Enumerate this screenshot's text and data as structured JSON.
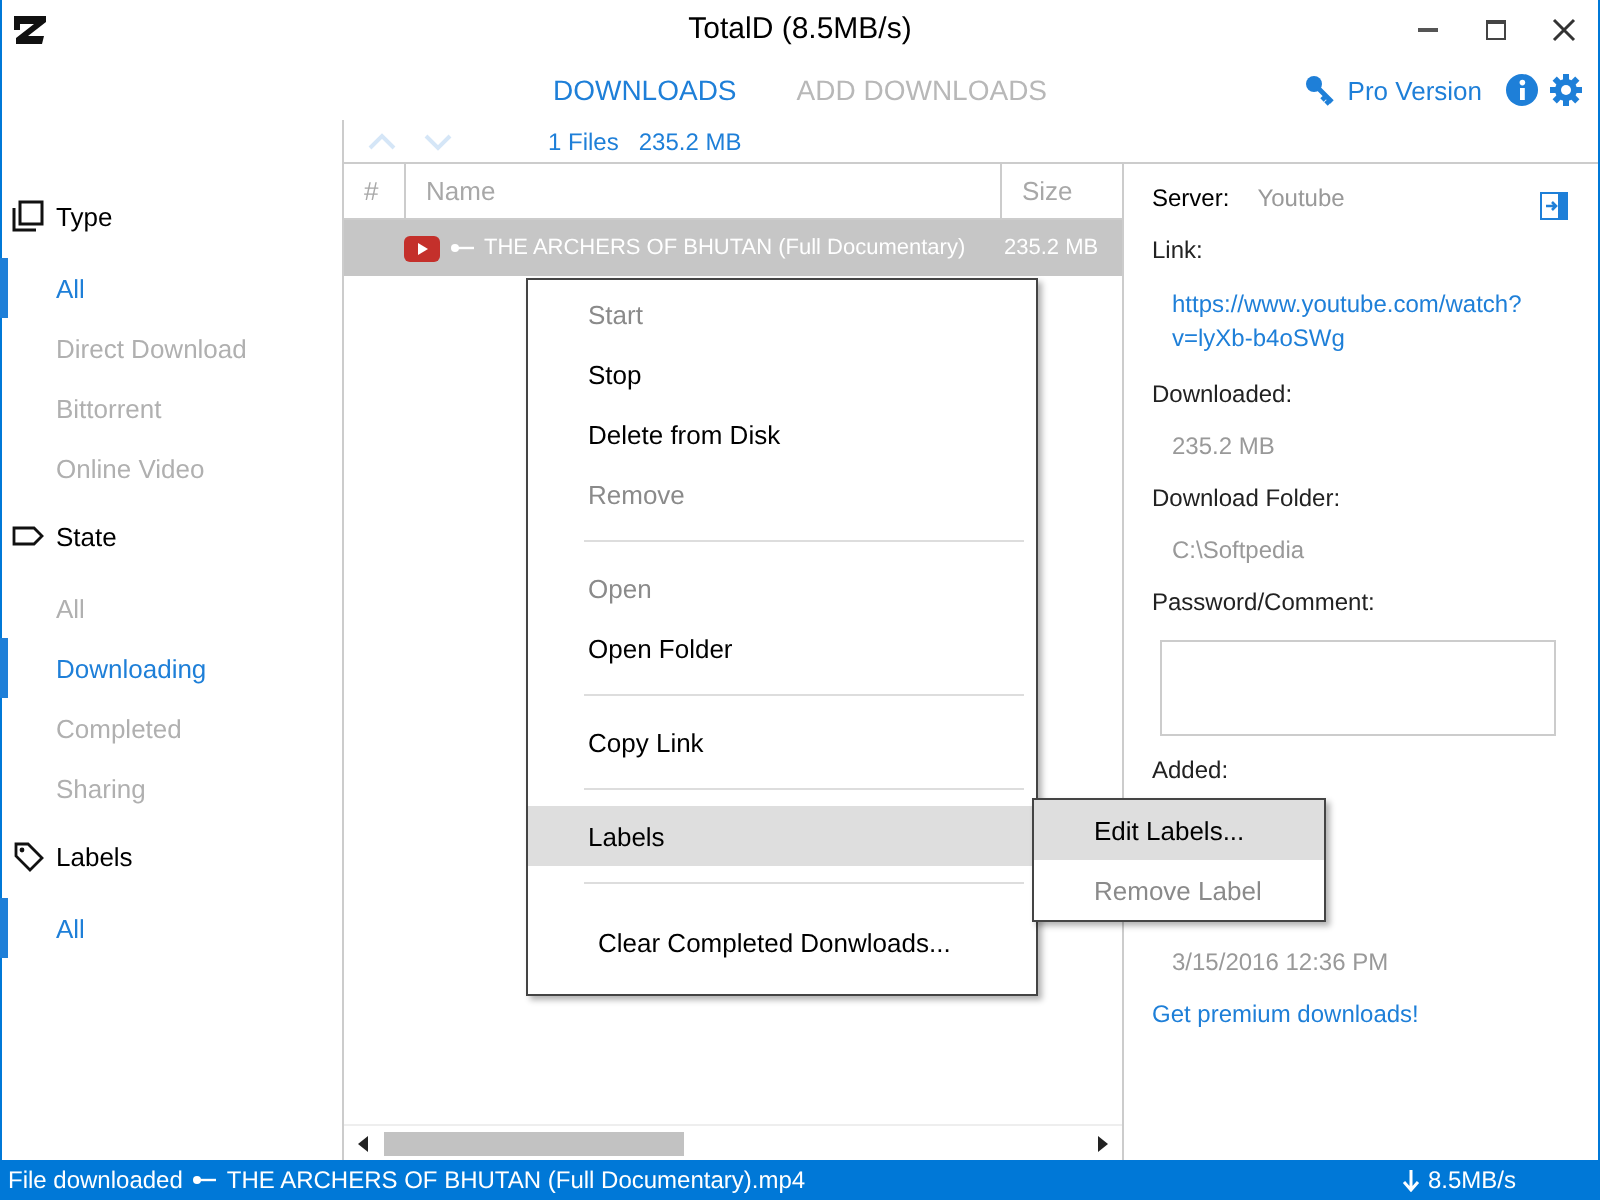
{
  "window": {
    "title": "TotalD (8.5MB/s)"
  },
  "tabs": [
    {
      "label": "DOWNLOADS",
      "selected": true
    },
    {
      "label": "ADD DOWNLOADS",
      "selected": false
    }
  ],
  "pro_link": "Pro Version",
  "toolbar": {
    "files": "1 Files",
    "size": "235.2 MB"
  },
  "sidebar": {
    "sections": [
      {
        "title": "Type",
        "items": [
          {
            "label": "All",
            "selected": true
          },
          {
            "label": "Direct Download",
            "selected": false
          },
          {
            "label": "Bittorrent",
            "selected": false
          },
          {
            "label": "Online Video",
            "selected": false
          }
        ]
      },
      {
        "title": "State",
        "items": [
          {
            "label": "All",
            "selected": false
          },
          {
            "label": "Downloading",
            "selected": true
          },
          {
            "label": "Completed",
            "selected": false
          },
          {
            "label": "Sharing",
            "selected": false
          }
        ]
      },
      {
        "title": "Labels",
        "items": [
          {
            "label": "All",
            "selected": true
          }
        ]
      }
    ]
  },
  "table": {
    "columns": [
      "#",
      "Name",
      "Size"
    ],
    "rows": [
      {
        "name": "THE ARCHERS OF BHUTAN (Full Documentary)",
        "size": "235.2 MB",
        "selected": true
      }
    ]
  },
  "details": {
    "server_label": "Server:",
    "server": "Youtube",
    "fields": [
      {
        "kind": "link",
        "label": "Link:",
        "value": "https://www.youtube.com/watch?v=lyXb-b4oSWg"
      },
      {
        "kind": "text",
        "label": "Downloaded:",
        "value": "235.2 MB"
      },
      {
        "kind": "text",
        "label": "Download Folder:",
        "value": "C:\\Softpedia"
      },
      {
        "kind": "input",
        "label": "Password/Comment:"
      },
      {
        "kind": "covered",
        "label": "Added:"
      },
      {
        "kind": "text",
        "value": "3/15/2016 12:36 PM"
      }
    ],
    "premium_link": "Get premium downloads!"
  },
  "context_menu": {
    "items": [
      {
        "kind": "item",
        "label": "Start",
        "disabled": true,
        "highlighted": false
      },
      {
        "kind": "item",
        "label": "Stop",
        "disabled": false,
        "highlighted": false
      },
      {
        "kind": "item",
        "label": "Delete from Disk",
        "disabled": false,
        "highlighted": false
      },
      {
        "kind": "item",
        "label": "Remove",
        "disabled": true,
        "highlighted": false
      },
      {
        "kind": "separator"
      },
      {
        "kind": "item",
        "label": "Open",
        "disabled": true,
        "highlighted": false
      },
      {
        "kind": "item",
        "label": "Open Folder",
        "disabled": false,
        "highlighted": false
      },
      {
        "kind": "separator"
      },
      {
        "kind": "item",
        "label": "Copy Link",
        "disabled": false,
        "highlighted": false
      },
      {
        "kind": "separator"
      },
      {
        "kind": "item",
        "label": "Labels",
        "disabled": false,
        "highlighted": true
      },
      {
        "kind": "separator"
      },
      {
        "kind": "item",
        "label": "Clear Completed Donwloads...",
        "disabled": false,
        "highlighted": false
      }
    ],
    "submenu": [
      {
        "label": "Edit Labels...",
        "disabled": false,
        "highlighted": true
      },
      {
        "label": "Remove Label",
        "disabled": true,
        "highlighted": false
      }
    ]
  },
  "status_bar": {
    "message": "File downloaded",
    "file": "THE ARCHERS OF BHUTAN (Full Documentary).mp4",
    "speed": "8.5MB/s"
  }
}
